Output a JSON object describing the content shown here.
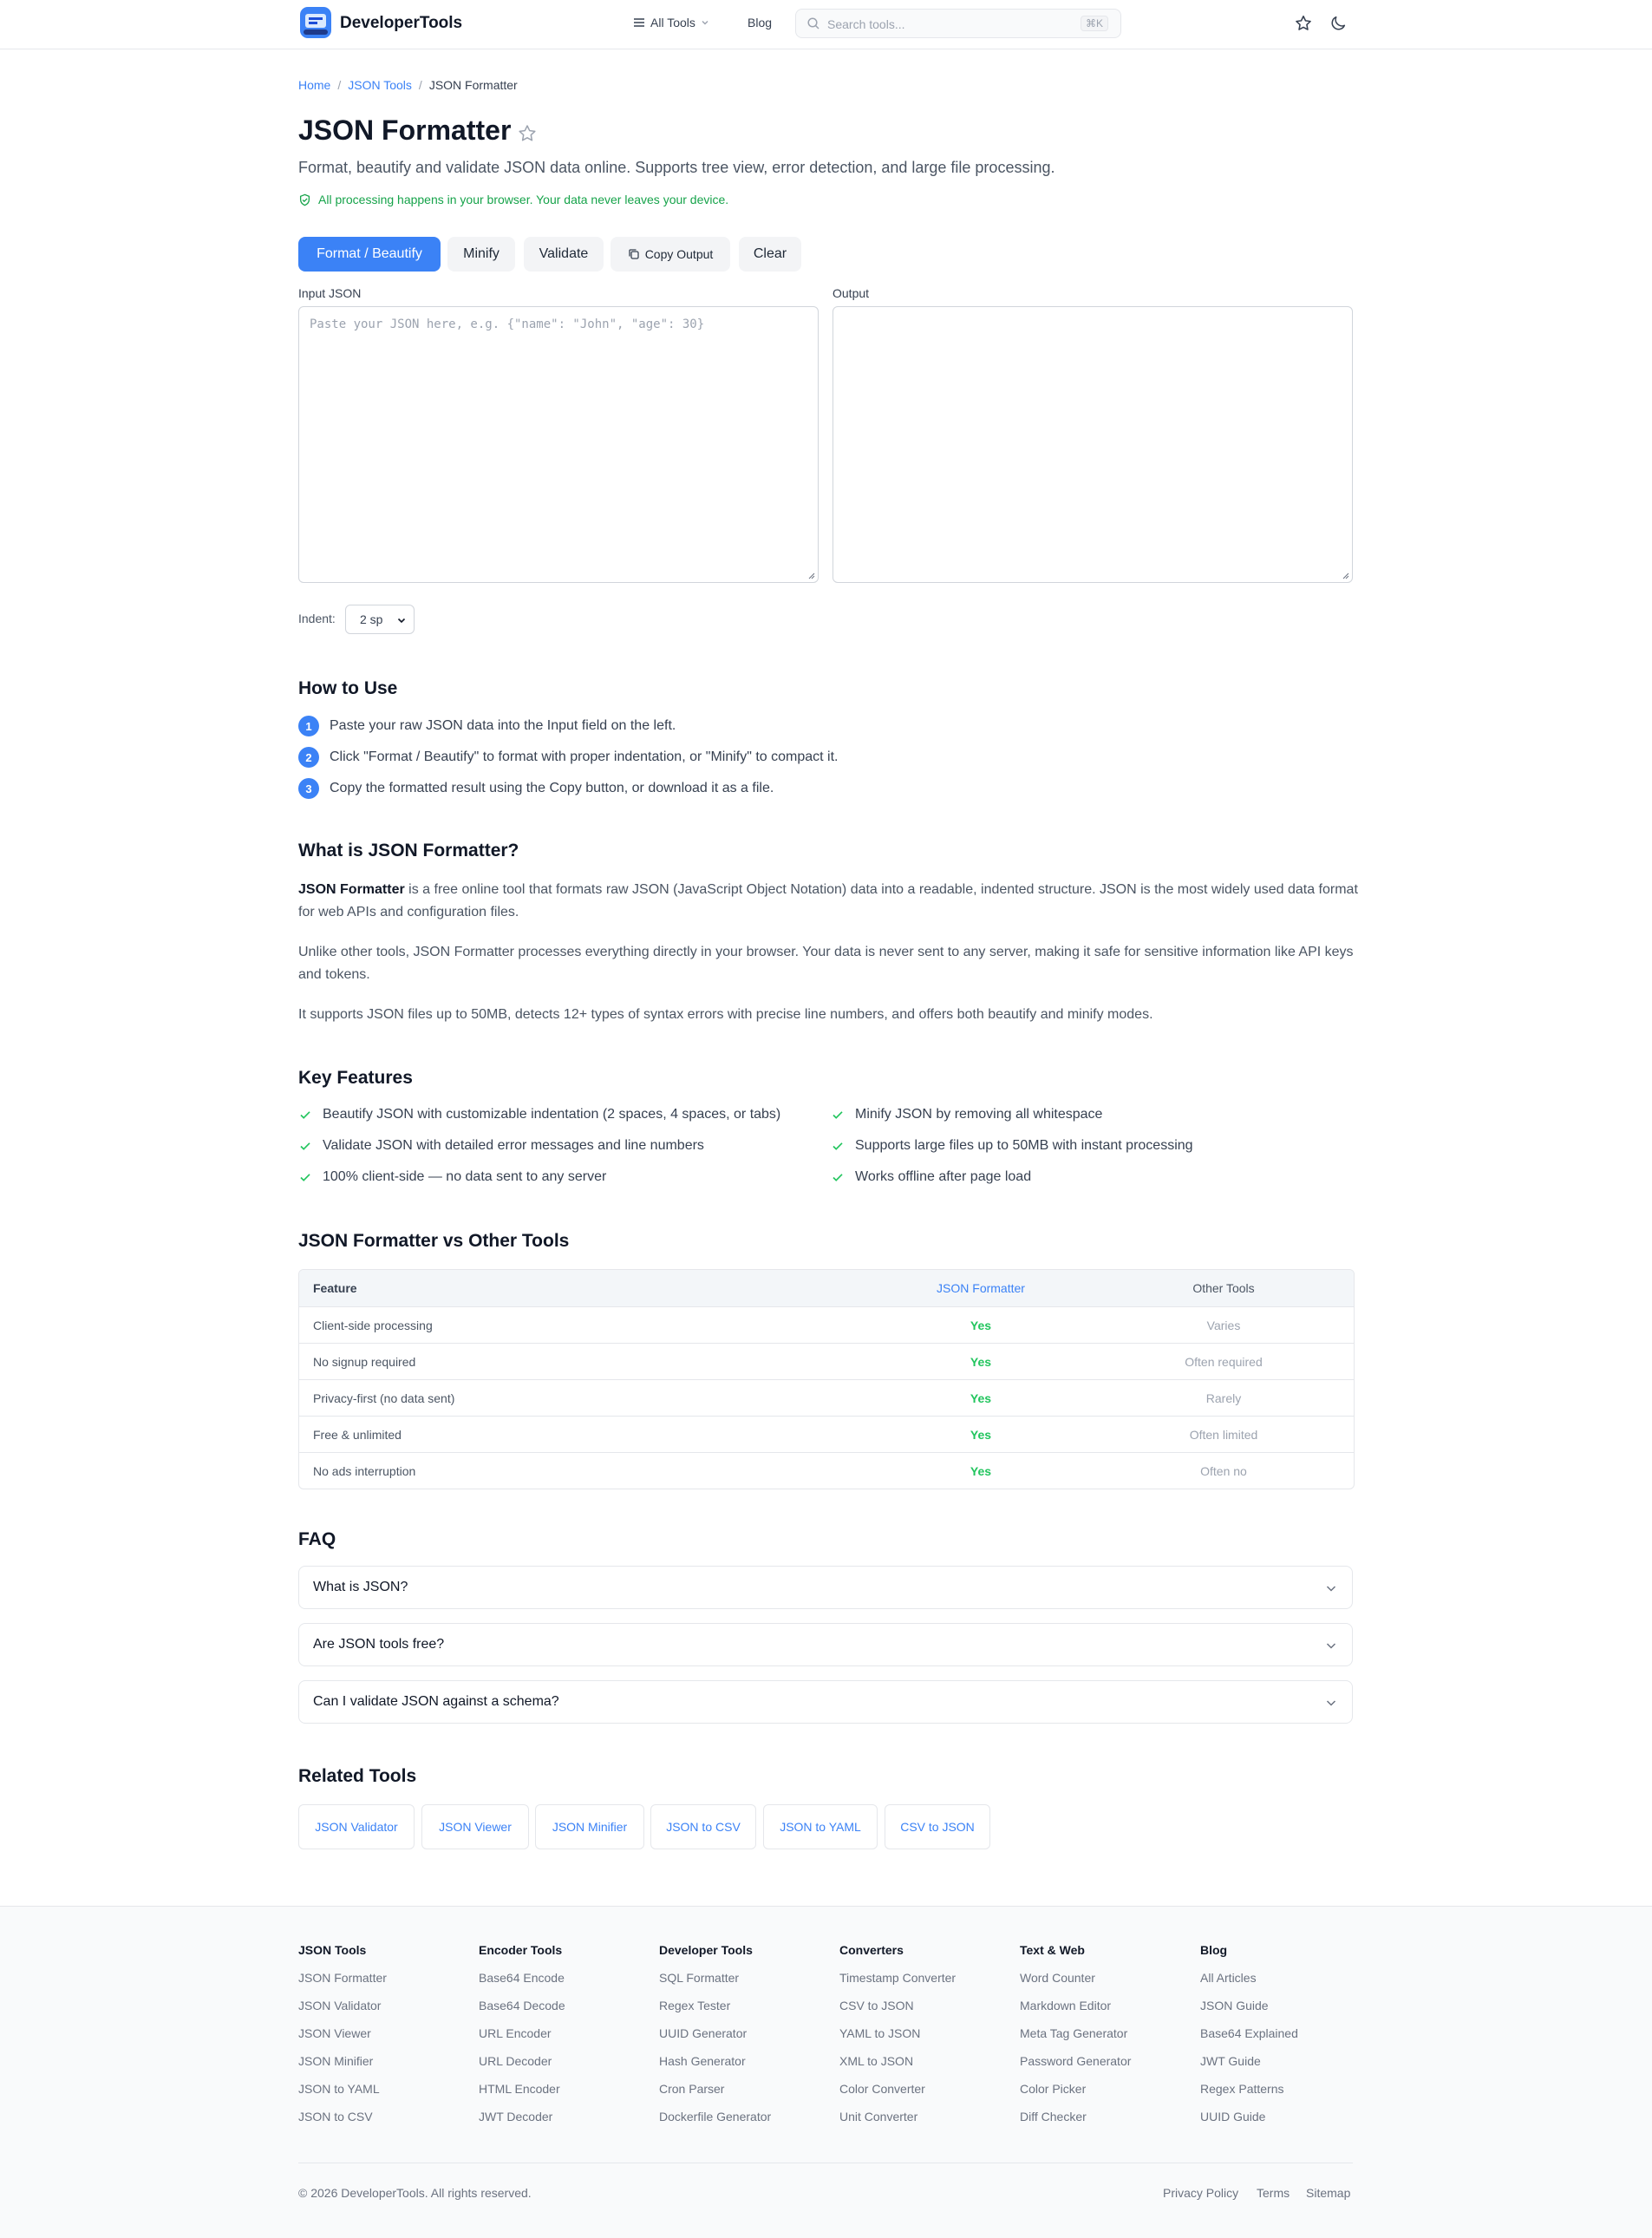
{
  "header": {
    "brand": "DeveloperTools",
    "all_tools": "All Tools",
    "blog": "Blog",
    "search_placeholder": "Search tools...",
    "search_shortcut": "⌘K"
  },
  "breadcrumb": {
    "home": "Home",
    "section": "JSON Tools",
    "current": "JSON Formatter",
    "separator": "/"
  },
  "page": {
    "title": "JSON Formatter",
    "subtitle": "Format, beautify and validate JSON data online. Supports tree view, error detection, and large file processing.",
    "privacy_note": "All processing happens in your browser. Your data never leaves your device."
  },
  "toolbar": {
    "format": "Format / Beautify",
    "minify": "Minify",
    "validate": "Validate",
    "copy": "Copy Output",
    "clear": "Clear"
  },
  "editor": {
    "input_label": "Input JSON",
    "input_placeholder": "Paste your JSON here, e.g. {\"name\": \"John\", \"age\": 30}",
    "input_value": "",
    "output_label": "Output",
    "output_value": "",
    "indent_label": "Indent:",
    "indent_value": "2 sp"
  },
  "how_to": {
    "heading": "How to Use",
    "steps": [
      {
        "num": "1",
        "text": "Paste your raw JSON data into the Input field on the left."
      },
      {
        "num": "2",
        "text": "Click \"Format / Beautify\" to format with proper indentation, or \"Minify\" to compact it."
      },
      {
        "num": "3",
        "text": "Copy the formatted result using the Copy button, or download it as a file."
      }
    ]
  },
  "what_is": {
    "heading": "What is JSON Formatter?",
    "p1_bold": "JSON Formatter",
    "p1_rest": " is a free online tool that formats raw JSON (JavaScript Object Notation) data into a readable, indented structure. JSON is the most widely used data format for web APIs and configuration files.",
    "p2": "Unlike other tools, JSON Formatter processes everything directly in your browser. Your data is never sent to any server, making it safe for sensitive information like API keys and tokens.",
    "p3": "It supports JSON files up to 50MB, detects 12+ types of syntax errors with precise line numbers, and offers both beautify and minify modes."
  },
  "features": {
    "heading": "Key Features",
    "items": [
      "Beautify JSON with customizable indentation (2 spaces, 4 spaces, or tabs)",
      "Minify JSON by removing all whitespace",
      "Validate JSON with detailed error messages and line numbers",
      "Supports large files up to 50MB with instant processing",
      "100% client-side — no data sent to any server",
      "Works offline after page load"
    ]
  },
  "comparison": {
    "heading": "JSON Formatter vs Other Tools",
    "columns": [
      "Feature",
      "JSON Formatter",
      "Other Tools"
    ],
    "rows": [
      [
        "Client-side processing",
        "Yes",
        "Varies"
      ],
      [
        "No signup required",
        "Yes",
        "Often required"
      ],
      [
        "Privacy-first (no data sent)",
        "Yes",
        "Rarely"
      ],
      [
        "Free & unlimited",
        "Yes",
        "Often limited"
      ],
      [
        "No ads interruption",
        "Yes",
        "Often no"
      ]
    ]
  },
  "faq": {
    "heading": "FAQ",
    "items": [
      "What is JSON?",
      "Are JSON tools free?",
      "Can I validate JSON against a schema?"
    ]
  },
  "related": {
    "heading": "Related Tools",
    "items": [
      "JSON Validator",
      "JSON Viewer",
      "JSON Minifier",
      "JSON to CSV",
      "JSON to YAML",
      "CSV to JSON"
    ]
  },
  "footer": {
    "columns": [
      {
        "title": "JSON Tools",
        "links": [
          "JSON Formatter",
          "JSON Validator",
          "JSON Viewer",
          "JSON Minifier",
          "JSON to YAML",
          "JSON to CSV"
        ]
      },
      {
        "title": "Encoder Tools",
        "links": [
          "Base64 Encode",
          "Base64 Decode",
          "URL Encoder",
          "URL Decoder",
          "HTML Encoder",
          "JWT Decoder"
        ]
      },
      {
        "title": "Developer Tools",
        "links": [
          "SQL Formatter",
          "Regex Tester",
          "UUID Generator",
          "Hash Generator",
          "Cron Parser",
          "Dockerfile Generator"
        ]
      },
      {
        "title": "Converters",
        "links": [
          "Timestamp Converter",
          "CSV to JSON",
          "YAML to JSON",
          "XML to JSON",
          "Color Converter",
          "Unit Converter"
        ]
      },
      {
        "title": "Text & Web",
        "links": [
          "Word Counter",
          "Markdown Editor",
          "Meta Tag Generator",
          "Password Generator",
          "Color Picker",
          "Diff Checker"
        ]
      },
      {
        "title": "Blog",
        "links": [
          "All Articles",
          "JSON Guide",
          "Base64 Explained",
          "JWT Guide",
          "Regex Patterns",
          "UUID Guide"
        ]
      }
    ],
    "copyright": "© 2026 DeveloperTools. All rights reserved.",
    "privacy": "Privacy Policy",
    "terms": "Terms",
    "sitemap": "Sitemap"
  },
  "colors": {
    "accent": "#3b82f6",
    "success": "#22c55e",
    "privacy_green": "#16a34a"
  }
}
